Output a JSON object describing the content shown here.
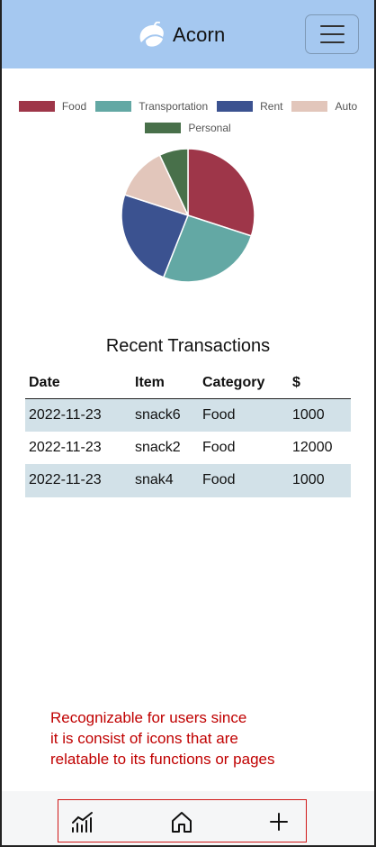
{
  "header": {
    "app_name": "Acorn",
    "brand_icon": "acorn-logo",
    "menu_icon": "hamburger-menu-icon"
  },
  "chart_data": {
    "type": "pie",
    "legend_position": "top",
    "categories": [
      "Food",
      "Transportation",
      "Rent",
      "Auto",
      "Personal"
    ],
    "values": [
      30,
      26,
      24,
      13,
      7
    ],
    "colors": [
      "#9e3649",
      "#63a8a4",
      "#3b5290",
      "#e2c6bb",
      "#48704a"
    ]
  },
  "transactions": {
    "title": "Recent Transactions",
    "columns": [
      "Date",
      "Item",
      "Category",
      "$"
    ],
    "rows": [
      [
        "2022-11-23",
        "snack6",
        "Food",
        "1000"
      ],
      [
        "2022-11-23",
        "snack2",
        "Food",
        "12000"
      ],
      [
        "2022-11-23",
        "snak4",
        "Food",
        "1000"
      ]
    ]
  },
  "annotation": {
    "lines": [
      "Recognizable for users since",
      "it is consist of icons that are",
      "relatable to its functions or pages"
    ],
    "color": "#c00000"
  },
  "bottom_nav": {
    "items": [
      {
        "icon": "stats-chart-icon"
      },
      {
        "icon": "home-icon"
      },
      {
        "icon": "plus-icon"
      }
    ],
    "highlight_color": "#d01818"
  }
}
